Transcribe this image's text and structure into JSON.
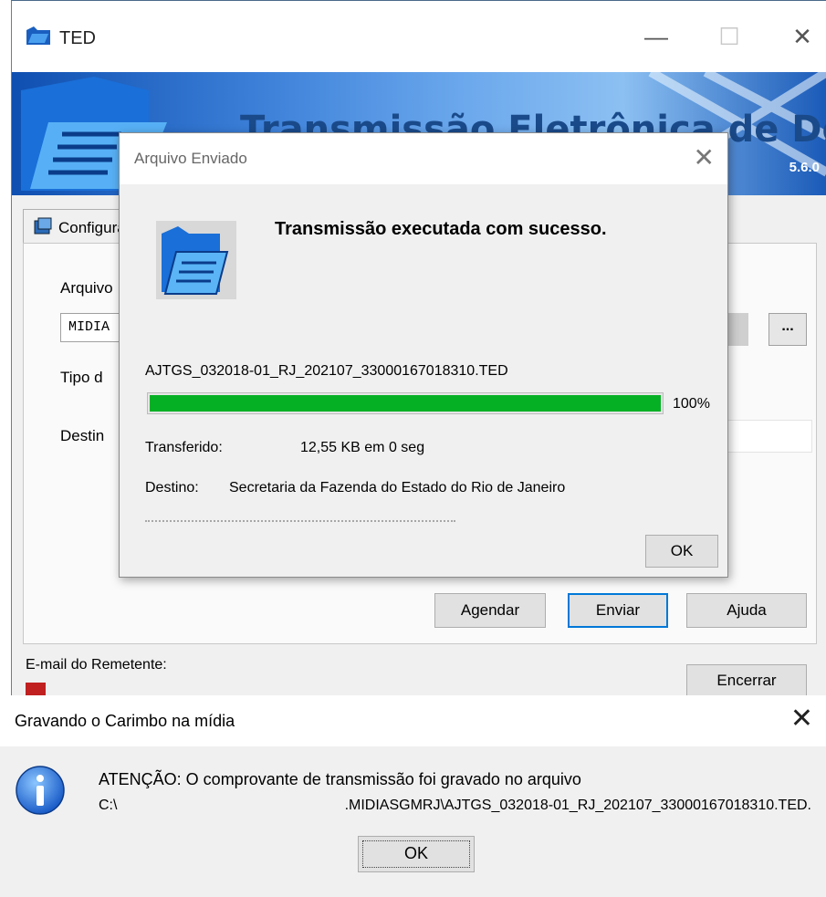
{
  "main_window": {
    "title": "TED",
    "banner_title": "Transmissão Eletrônica de Documentos",
    "banner_version": "5.6.0",
    "tab_label": "Configuração",
    "labels": {
      "arquivo": "Arquivo",
      "tipo": "Tipo d",
      "destino": "Destin",
      "email": "E-mail do Remetente:"
    },
    "arquivo_value": "MIDIA",
    "browse_label": "...",
    "buttons": {
      "agendar": "Agendar",
      "enviar": "Enviar",
      "ajuda": "Ajuda",
      "encerrar": "Encerrar"
    }
  },
  "sent_dialog": {
    "title": "Arquivo Enviado",
    "headline": "Transmissão executada com sucesso.",
    "filename": "AJTGS_032018-01_RJ_202107_33000167018310.TED",
    "progress_percent": "100%",
    "progress_value": 100,
    "transferido_label": "Transferido:",
    "transferido_value": "12,55 KB em 0 seg",
    "destino_label": "Destino:",
    "destino_value": "Secretaria da Fazenda do Estado do Rio de Janeiro",
    "ok_label": "OK"
  },
  "stamp_dialog": {
    "title": "Gravando o Carimbo na mídia",
    "message": "ATENÇÃO: O comprovante de transmissão foi gravado no arquivo",
    "path_prefix": "C:\\",
    "path": ".MIDIASGMRJ\\AJTGS_032018-01_RJ_202107_33000167018310.TED.",
    "ok_label": "OK"
  },
  "colors": {
    "progress": "#06b025",
    "accent": "#0078d7",
    "banner": "#3b7fd8"
  }
}
